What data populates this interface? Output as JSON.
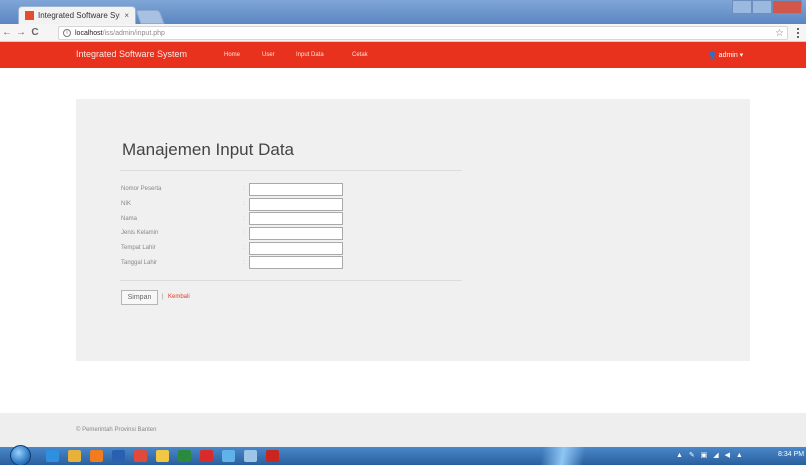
{
  "browser": {
    "tab_title": "Integrated Software Sys",
    "tab_close": "×",
    "url_host": "localhost",
    "url_path": "/iss/admin/input.php",
    "back": "←",
    "forward": "→",
    "reload": "C",
    "star": "☆",
    "info": "i"
  },
  "navbar": {
    "brand": "Integrated Software System",
    "links": [
      "Home",
      "User",
      "Input Data",
      "Cetak"
    ],
    "user_menu": "admin ▾",
    "color": "#e8321e"
  },
  "page": {
    "title": "Manajemen Input Data",
    "fields": [
      {
        "label": "Nomor Peserta",
        "sep": ":",
        "value": ""
      },
      {
        "label": "NIK",
        "sep": ":",
        "value": ""
      },
      {
        "label": "Nama",
        "sep": ":",
        "value": ""
      },
      {
        "label": "Jenis Kelamin",
        "sep": ":",
        "value": ""
      },
      {
        "label": "Tempat Lahir",
        "sep": ":",
        "value": ""
      },
      {
        "label": "Tanggal Lahir",
        "sep": ":",
        "value": ""
      }
    ],
    "save_label": "Simpan",
    "separator": "|",
    "back_link": "Kembali"
  },
  "footer": {
    "text": "© Pemerintah Provinsi Banten"
  },
  "taskbar": {
    "tray": "▲ ✎ ▣ ◢ ◀ ▲",
    "clock": "8:34 PM",
    "icons": [
      "ie-icon",
      "explorer-icon",
      "media-icon",
      "word-icon",
      "chrome-icon",
      "folder-icon",
      "excel-icon",
      "opera-icon",
      "network-icon",
      "calculator-icon",
      "pdf-icon"
    ]
  }
}
